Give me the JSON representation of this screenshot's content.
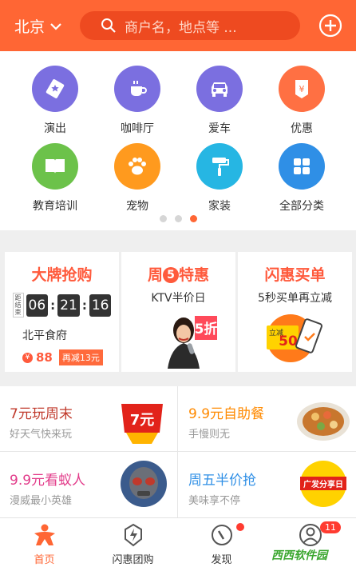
{
  "header": {
    "city": "北京",
    "search_placeholder": "商户名，地点等 ..."
  },
  "categories": [
    {
      "label": "演出",
      "color": "#7b6fe0",
      "icon": "ticket-icon"
    },
    {
      "label": "咖啡厅",
      "color": "#7b6fe0",
      "icon": "coffee-icon"
    },
    {
      "label": "爱车",
      "color": "#7b6fe0",
      "icon": "car-icon"
    },
    {
      "label": "优惠",
      "color": "#ff7043",
      "icon": "coupon-icon"
    },
    {
      "label": "教育培训",
      "color": "#6cc24a",
      "icon": "book-icon"
    },
    {
      "label": "宠物",
      "color": "#ff9a1e",
      "icon": "paw-icon"
    },
    {
      "label": "家装",
      "color": "#26b6e3",
      "icon": "paint-roller-icon"
    },
    {
      "label": "全部分类",
      "color": "#2f8fe6",
      "icon": "grid-icon"
    }
  ],
  "pager": {
    "count": 3,
    "active": 3
  },
  "promos": {
    "flash": {
      "title": "大牌抢购",
      "countdown_label": "距结束",
      "hours": "06",
      "minutes": "21",
      "seconds": "16",
      "shop": "北平食府",
      "yen": "¥",
      "price": "88",
      "reduce": "再减13元"
    },
    "friday": {
      "title_pre": "周",
      "title_num": "5",
      "title_post": "特惠",
      "sub": "KTV半价日",
      "tag": "5折"
    },
    "flashpay": {
      "title": "闪惠买单",
      "sub": "5秒买单再立减",
      "tag_small": "立减",
      "tag_big": "50"
    }
  },
  "deals": [
    {
      "title": "7元玩周末",
      "sub": "好天气快来玩",
      "color": "#c0392b",
      "badge": "7元"
    },
    {
      "title": "9.9元自助餐",
      "sub": "手慢则无",
      "color": "#ff8a00"
    },
    {
      "title": "9.9元看蚁人",
      "sub": "漫威最小英雄",
      "color": "#e23b8a"
    },
    {
      "title": "周五半价抢",
      "sub": "美味享不停",
      "color": "#2f8fe6",
      "badge": "广发分享日"
    }
  ],
  "nav": [
    {
      "label": "首页",
      "icon": "home-icon",
      "active": true
    },
    {
      "label": "闪惠团购",
      "icon": "lightning-tag-icon"
    },
    {
      "label": "发现",
      "icon": "discover-icon",
      "dot": true
    },
    {
      "label": "",
      "icon": "user-icon",
      "badge": "11"
    }
  ],
  "watermark": "西西软件园",
  "colors": {
    "accent": "#ff6634",
    "search_bg": "#ee4a20"
  }
}
